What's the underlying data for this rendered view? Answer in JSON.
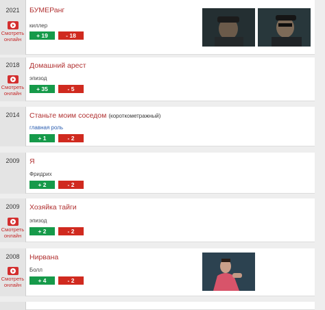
{
  "watch_label_line1": "Смотреть",
  "watch_label_line2": "онлайн",
  "watch_icon": "play-icon",
  "films": [
    {
      "year": "2021",
      "title": "БУМЕРанг",
      "note": "",
      "role": "киллер",
      "up": "+ 19",
      "down": "- 18",
      "thumbs": 2
    },
    {
      "year": "2018",
      "title": "Домашний арест",
      "note": "",
      "role": "эпизод",
      "up": "+ 35",
      "down": "- 5",
      "thumbs": 0
    },
    {
      "year": "2014",
      "title": "Станьте моим соседом",
      "note": "(короткометражный)",
      "role": "главная роль",
      "up": "+ 1",
      "down": "- 2",
      "thumbs": 0
    },
    {
      "year": "2009",
      "title": "Я",
      "note": "",
      "role": "Фридрих",
      "up": "+ 2",
      "down": "- 2",
      "thumbs": 0
    },
    {
      "year": "2009",
      "title": "Хозяйка тайги",
      "note": "",
      "role": "эпизод",
      "up": "+ 2",
      "down": "- 2",
      "thumbs": 0
    },
    {
      "year": "2008",
      "title": "Нирвана",
      "note": "",
      "role": "Болл",
      "up": "+ 4",
      "down": "- 2",
      "thumbs": 1
    }
  ]
}
